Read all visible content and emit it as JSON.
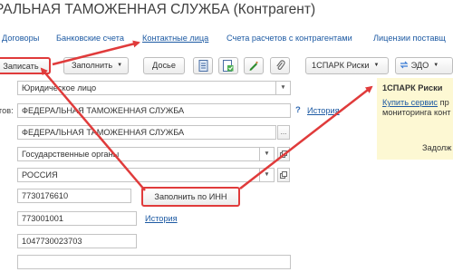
{
  "window": {
    "title": "РАЛЬНАЯ ТАМОЖЕННАЯ СЛУЖБА (Контрагент)"
  },
  "nav": [
    {
      "label": "Договоры"
    },
    {
      "label": "Банковские счета"
    },
    {
      "label": "Контактные лица"
    },
    {
      "label": "Счета расчетов с контрагентами"
    },
    {
      "label": "Лицензии поставщ"
    }
  ],
  "toolbar": {
    "save_label": "Записать",
    "fill_label": "Заполнить",
    "dossier_label": "Досье",
    "spark_label": "1СПАРК Риски",
    "edo_label": "ЭДО"
  },
  "form": {
    "legal_type": "Юридическое лицо",
    "name_label": "тов:",
    "short_name": "ФЕДЕРАЛЬНАЯ ТАМОЖЕННАЯ СЛУЖБА",
    "full_name": "ФЕДЕРАЛЬНАЯ ТАМОЖЕННАЯ СЛУЖБА",
    "group": "Государственные органы",
    "country": "РОССИЯ",
    "inn": "7730176610",
    "fill_by_inn_label": "Заполнить по ИНН",
    "kpp": "773001001",
    "ogrn": "1047730023703",
    "history_link_1": "История",
    "history_link_2": "История",
    "help_mark": "?",
    "ellipsis": "..."
  },
  "spark_panel": {
    "title": "1СПАРК Риски",
    "buy_link": "Купить сервис",
    "text_tail": "пр",
    "text_line2": "мониторинга конт",
    "footer": "Задолж"
  },
  "colors": {
    "accent_red": "#e03b3b",
    "link_blue": "#1d5aa3",
    "panel_bg": "#fdf8d3"
  }
}
